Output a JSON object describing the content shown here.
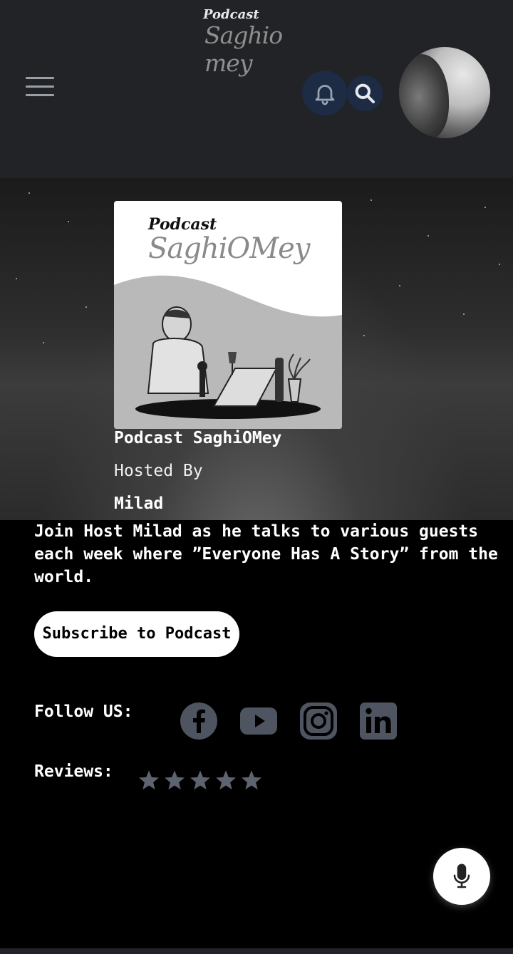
{
  "header": {
    "logo_line1": "Podcast",
    "logo_line2": "Saghio mey"
  },
  "icons": {
    "menu": "hamburger-menu-icon",
    "bell": "bell-icon",
    "search": "search-icon",
    "facebook": "facebook-icon",
    "youtube": "youtube-icon",
    "instagram": "instagram-icon",
    "linkedin": "linkedin-icon",
    "star": "star-icon",
    "mic": "microphone-icon"
  },
  "podcast": {
    "cover_line1": "Podcast",
    "cover_line2": "SaghiOMey",
    "title": "Podcast SaghiOMey",
    "hosted_by_label": "Hosted By",
    "host_name": "Milad",
    "description": "Join Host Milad as he talks to various guests each week where ”Everyone Has A Story” from the world."
  },
  "actions": {
    "subscribe_label": "Subscribe to Podcast"
  },
  "follow": {
    "label": "Follow US:"
  },
  "reviews": {
    "label": "Reviews:",
    "rating": 5,
    "max_rating": 5
  },
  "colors": {
    "header_bg": "#222326",
    "page_bg": "#000000",
    "icon_circle_bg": "#1d2b45",
    "social_icon": "#4e5460",
    "star": "#5e6370"
  }
}
